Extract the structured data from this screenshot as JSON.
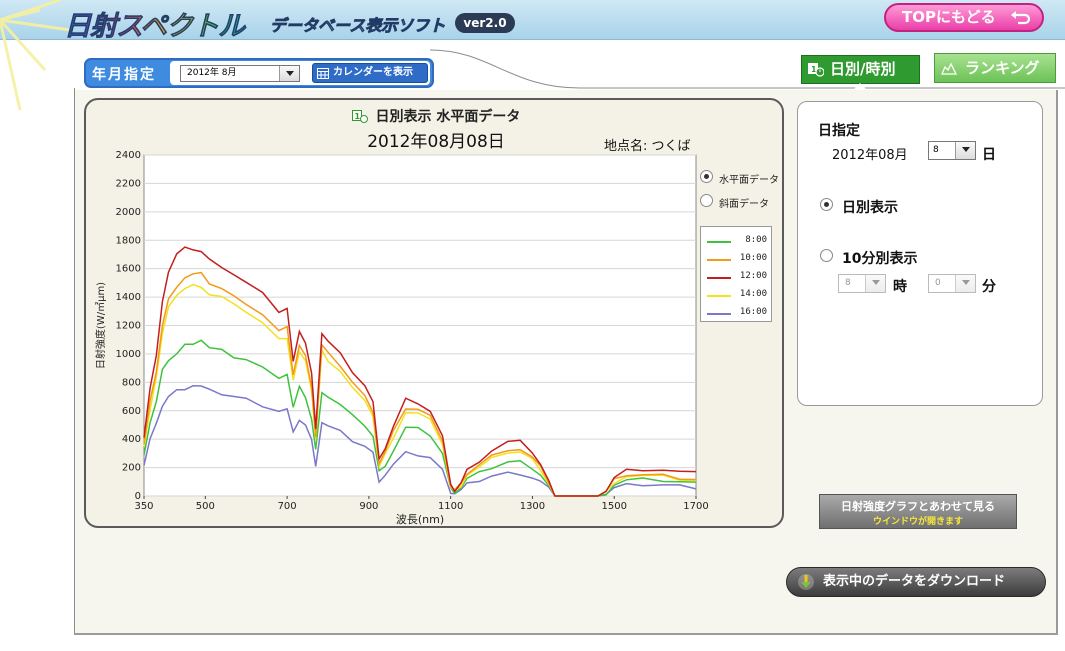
{
  "header": {
    "logo": "日射スペクトル",
    "subtitle": "データベース表示ソフト",
    "version": "ver2.0",
    "top_button": "TOPにもどる"
  },
  "year_month": {
    "label": "年月指定",
    "selected": "2012年 8月",
    "calendar_button": "カレンダーを表示"
  },
  "tabs": {
    "daily": "日別/時別",
    "ranking": "ランキング"
  },
  "chart_panel": {
    "title": "日別表示 水平面データ",
    "date": "2012年08月08日",
    "location": "地点名: つくば",
    "radio_horizontal": "水平面データ",
    "radio_slope": "斜面データ"
  },
  "right_panel": {
    "title": "日指定",
    "year_month": "2012年08月",
    "day_value": "8",
    "day_unit": "日",
    "radio_daily": "日別表示",
    "radio_10min": "10分別表示",
    "hour_value": "8",
    "hour_unit": "時",
    "minute_value": "0",
    "minute_unit": "分"
  },
  "buttons": {
    "graph_line1": "日射強度グラフとあわせて見る",
    "graph_line2": "ウインドウが開きます",
    "download": "表示中のデータをダウンロード"
  },
  "colors": {
    "s8": "#3fc23f",
    "s10": "#f39a1a",
    "s12": "#c21f1f",
    "s14": "#f2e11e",
    "s16": "#7a78c9"
  },
  "chart_data": {
    "type": "line",
    "xlabel": "波長(nm)",
    "ylabel": "日射強度(W/㎡µm)",
    "xlim": [
      350,
      1700
    ],
    "ylim": [
      0,
      2400
    ],
    "xticks": [
      350,
      500,
      700,
      900,
      1100,
      1300,
      1500,
      1700
    ],
    "yticks": [
      0,
      200,
      400,
      600,
      800,
      1000,
      1200,
      1400,
      1600,
      1800,
      2000,
      2200,
      2400
    ],
    "grid": true,
    "legend_position": "right",
    "x": [
      350,
      365,
      380,
      395,
      410,
      430,
      450,
      470,
      490,
      510,
      540,
      570,
      600,
      640,
      680,
      700,
      715,
      730,
      745,
      760,
      770,
      785,
      800,
      830,
      860,
      890,
      910,
      925,
      940,
      960,
      990,
      1020,
      1050,
      1080,
      1100,
      1110,
      1125,
      1140,
      1170,
      1200,
      1240,
      1270,
      1300,
      1320,
      1340,
      1355,
      1380,
      1420,
      1460,
      1480,
      1500,
      1530,
      1570,
      1620,
      1660,
      1700
    ],
    "series": [
      {
        "name": "8:00",
        "values": [
          300,
          520,
          660,
          880,
          960,
          1000,
          1060,
          1080,
          1100,
          1040,
          1020,
          980,
          960,
          900,
          840,
          860,
          620,
          760,
          700,
          540,
          320,
          740,
          700,
          640,
          560,
          500,
          420,
          170,
          220,
          320,
          480,
          470,
          430,
          300,
          50,
          30,
          60,
          120,
          160,
          200,
          240,
          240,
          200,
          150,
          70,
          0,
          0,
          0,
          0,
          20,
          80,
          110,
          115,
          110,
          100,
          90
        ]
      },
      {
        "name": "10:00",
        "values": [
          360,
          660,
          880,
          1200,
          1380,
          1480,
          1540,
          1560,
          1560,
          1500,
          1460,
          1400,
          1360,
          1280,
          1160,
          1180,
          860,
          1060,
          980,
          780,
          420,
          1060,
          1000,
          920,
          800,
          700,
          600,
          230,
          310,
          450,
          620,
          610,
          560,
          400,
          70,
          40,
          80,
          160,
          220,
          280,
          330,
          330,
          270,
          200,
          100,
          0,
          0,
          0,
          0,
          30,
          110,
          150,
          150,
          145,
          130,
          120
        ]
      },
      {
        "name": "12:00",
        "values": [
          420,
          760,
          980,
          1380,
          1580,
          1700,
          1740,
          1740,
          1720,
          1660,
          1620,
          1560,
          1500,
          1420,
          1300,
          1320,
          940,
          1170,
          1080,
          860,
          460,
          1150,
          1090,
          1000,
          880,
          780,
          660,
          250,
          340,
          490,
          680,
          660,
          600,
          420,
          70,
          40,
          90,
          180,
          250,
          320,
          380,
          380,
          310,
          220,
          100,
          0,
          0,
          0,
          0,
          40,
          130,
          180,
          190,
          185,
          170,
          160
        ]
      },
      {
        "name": "14:00",
        "values": [
          340,
          620,
          840,
          1140,
          1320,
          1420,
          1460,
          1480,
          1480,
          1420,
          1400,
          1340,
          1300,
          1220,
          1100,
          1120,
          820,
          1010,
          940,
          750,
          400,
          1020,
          960,
          880,
          760,
          660,
          570,
          210,
          290,
          420,
          590,
          580,
          530,
          370,
          60,
          35,
          75,
          150,
          200,
          260,
          310,
          310,
          255,
          190,
          90,
          0,
          0,
          0,
          0,
          28,
          100,
          140,
          140,
          135,
          120,
          110
        ]
      },
      {
        "name": "16:00",
        "values": [
          220,
          400,
          500,
          640,
          700,
          740,
          760,
          780,
          770,
          740,
          720,
          700,
          680,
          640,
          600,
          610,
          440,
          540,
          500,
          390,
          220,
          520,
          490,
          450,
          390,
          350,
          300,
          110,
          150,
          220,
          300,
          290,
          270,
          180,
          30,
          20,
          40,
          80,
          110,
          140,
          160,
          160,
          130,
          100,
          50,
          0,
          0,
          0,
          0,
          15,
          55,
          75,
          80,
          78,
          70,
          62
        ]
      }
    ]
  }
}
